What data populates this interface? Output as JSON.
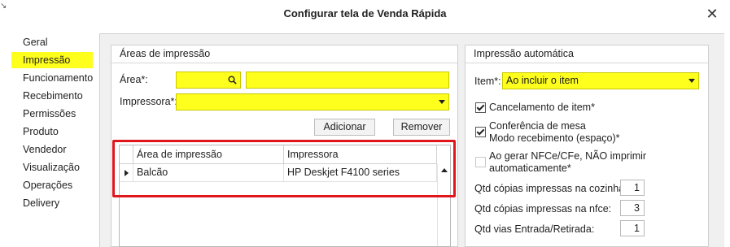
{
  "window": {
    "title": "Configurar tela de Venda Rápida",
    "close_label": "✕",
    "corner_mark": "↘"
  },
  "sidebar": {
    "items": [
      {
        "label": "Geral",
        "active": false
      },
      {
        "label": "Impressão",
        "active": true
      },
      {
        "label": "Funcionamento",
        "active": false
      },
      {
        "label": "Recebimento",
        "active": false
      },
      {
        "label": "Permissões",
        "active": false
      },
      {
        "label": "Produto",
        "active": false
      },
      {
        "label": "Vendedor",
        "active": false
      },
      {
        "label": "Visualização",
        "active": false
      },
      {
        "label": "Operações",
        "active": false
      },
      {
        "label": "Delivery",
        "active": false
      }
    ]
  },
  "areas_impressao": {
    "title": "Áreas de impressão",
    "area_label": "Área*:",
    "area_code_value": "",
    "area_name_value": "",
    "impressora_label": "Impressora*:",
    "impressora_value": "",
    "add_button": "Adicionar",
    "remove_button": "Remover",
    "grid": {
      "columns": [
        "Área de impressão",
        "Impressora"
      ],
      "rows": [
        {
          "area": "Balcão",
          "impressora": "HP Deskjet F4100 series"
        }
      ]
    }
  },
  "impressao_automatica": {
    "title": "Impressão automática",
    "item_label": "Item*:",
    "item_value": "Ao incluir o item",
    "checkboxes": [
      {
        "label": "Cancelamento de item*",
        "checked": true
      },
      {
        "label": "Conferência de mesa",
        "label2": "Modo recebimento (espaço)*",
        "checked": true
      },
      {
        "label": "Ao gerar NFCe/CFe, NÃO imprimir",
        "label2": "automaticamente*",
        "checked": false
      }
    ],
    "fields": [
      {
        "label": "Qtd cópias impressas na cozinha:",
        "value": "1"
      },
      {
        "label": "Qtd cópias impressas na nfce:",
        "value": "3"
      },
      {
        "label": "Qtd vias Entrada/Retirada:",
        "value": "1"
      }
    ]
  },
  "colors": {
    "highlight": "#ffff1e",
    "frame_red": "#e0161d"
  }
}
